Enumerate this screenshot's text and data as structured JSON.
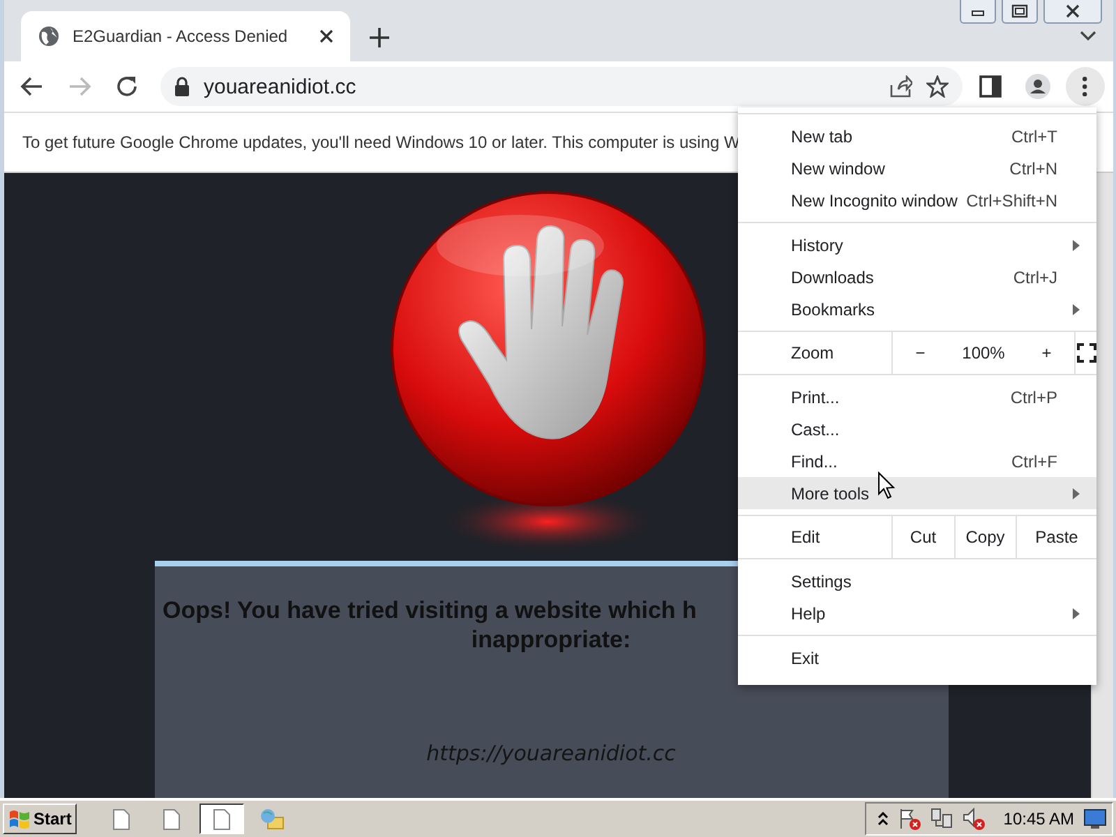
{
  "tab": {
    "title": "E2Guardian - Access Denied",
    "selected": true
  },
  "address": {
    "url": "youareanidiot.cc"
  },
  "infobar": {
    "text": "To get future Google Chrome updates, you'll need Windows 10 or later. This computer is using W"
  },
  "page": {
    "heading_lines": [
      "Oops! You have tried visiting a website which h",
      "inappropriate:"
    ],
    "blocked_url": "https://youareanidiot.cc"
  },
  "menu": {
    "sections": [
      [
        {
          "kind": "item",
          "label": "New tab",
          "shortcut": "Ctrl+T",
          "submenu": false,
          "selected": false
        },
        {
          "kind": "item",
          "label": "New window",
          "shortcut": "Ctrl+N",
          "submenu": false,
          "selected": false
        },
        {
          "kind": "item",
          "label": "New Incognito window",
          "shortcut": "Ctrl+Shift+N",
          "submenu": false,
          "selected": false
        }
      ],
      [
        {
          "kind": "item",
          "label": "History",
          "submenu": true,
          "selected": false
        },
        {
          "kind": "item",
          "label": "Downloads",
          "shortcut": "Ctrl+J",
          "submenu": false,
          "selected": false
        },
        {
          "kind": "item",
          "label": "Bookmarks",
          "submenu": true,
          "selected": false
        }
      ],
      [
        {
          "kind": "zoom",
          "label": "Zoom",
          "minus": "−",
          "value": "100%",
          "plus": "+"
        }
      ],
      [
        {
          "kind": "item",
          "label": "Print...",
          "shortcut": "Ctrl+P",
          "submenu": false,
          "selected": false
        },
        {
          "kind": "item",
          "label": "Cast...",
          "submenu": false,
          "selected": false
        },
        {
          "kind": "item",
          "label": "Find...",
          "shortcut": "Ctrl+F",
          "submenu": false,
          "selected": false
        },
        {
          "kind": "item",
          "label": "More tools",
          "submenu": true,
          "selected": true
        }
      ],
      [
        {
          "kind": "edit",
          "label": "Edit",
          "actions": [
            "Cut",
            "Copy",
            "Paste"
          ]
        }
      ],
      [
        {
          "kind": "item",
          "label": "Settings",
          "submenu": false,
          "selected": false
        },
        {
          "kind": "item",
          "label": "Help",
          "submenu": true,
          "selected": false
        }
      ],
      [
        {
          "kind": "item",
          "label": "Exit",
          "submenu": false,
          "selected": false
        }
      ]
    ]
  },
  "taskbar": {
    "start": "Start",
    "tasks": [
      {
        "kind": "document",
        "pressed": false
      },
      {
        "kind": "document",
        "pressed": false
      },
      {
        "kind": "document",
        "pressed": true
      },
      {
        "kind": "network",
        "pressed": false
      }
    ],
    "clock": "10:45 AM"
  }
}
